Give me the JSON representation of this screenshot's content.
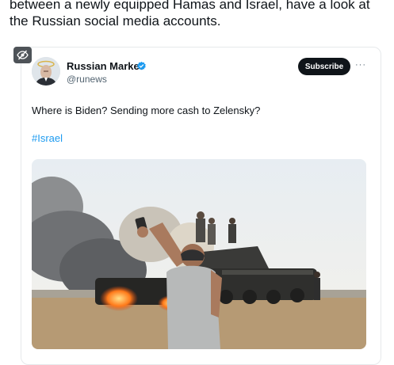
{
  "article": {
    "text": "between a newly equipped Hamas and Israel, have a look at the Russian social media accounts."
  },
  "tweet": {
    "author_name": "Russian Market",
    "handle": "@runews",
    "subscribe_label": "Subscribe",
    "more_label": "···",
    "text": "Where is Biden? Sending more cash to Zelensky?",
    "hashtag": "#Israel"
  },
  "colors": {
    "accent": "#1d9bf0",
    "button_bg": "#0f1419",
    "badge_bg": "#4e5358"
  },
  "icons": {
    "hidden": "eye-slash-icon",
    "verified": "verified-badge-icon",
    "more": "more-icon"
  }
}
